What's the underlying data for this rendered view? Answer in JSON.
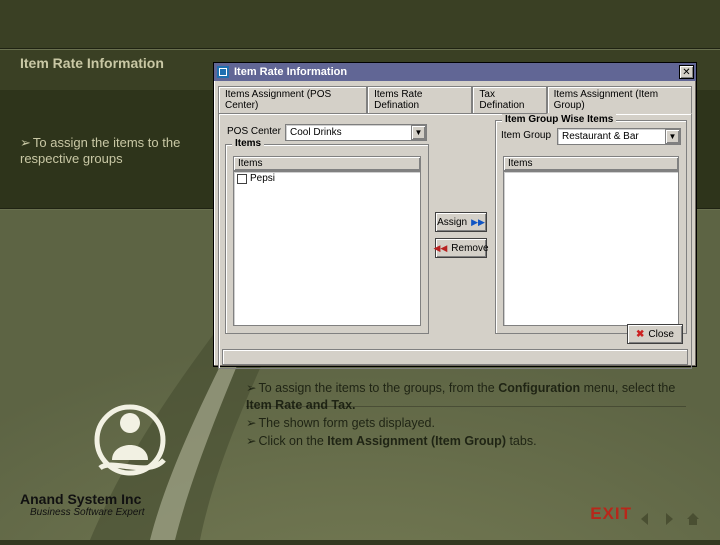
{
  "presentation": {
    "sidebar_title": "Item Rate Information",
    "sidebar_point": "To assign the items to the respective groups",
    "notes": {
      "l1a": "To assign the items to the groups, from the ",
      "l1b": "Configuration",
      "l1c": " menu, select the ",
      "l1d": "Item Rate and Tax.",
      "l2": "The shown form gets displayed.",
      "l3a": "Click on the ",
      "l3b": "Item Assignment (Item Group)",
      "l3c": " tabs."
    },
    "company": "Anand System Inc",
    "tagline": "Business Software Expert",
    "exit": "EXIT"
  },
  "dialog": {
    "title": "Item Rate Information",
    "tabs": [
      "Items Assignment (POS Center)",
      "Items Rate Defination",
      "Tax Defination",
      "Items Assignment (Item Group)"
    ],
    "active_tab_index": 3,
    "left": {
      "group_title": "Items",
      "pos_label": "POS Center",
      "pos_value": "Cool Drinks",
      "list_header": "Items",
      "list_item": "Pepsi"
    },
    "right": {
      "group_title": "Item Group Wise Items",
      "grp_label": "Item Group",
      "grp_value": "Restaurant & Bar",
      "list_header": "Items"
    },
    "buttons": {
      "assign": "Assign",
      "remove": "Remove",
      "close": "Close"
    }
  }
}
